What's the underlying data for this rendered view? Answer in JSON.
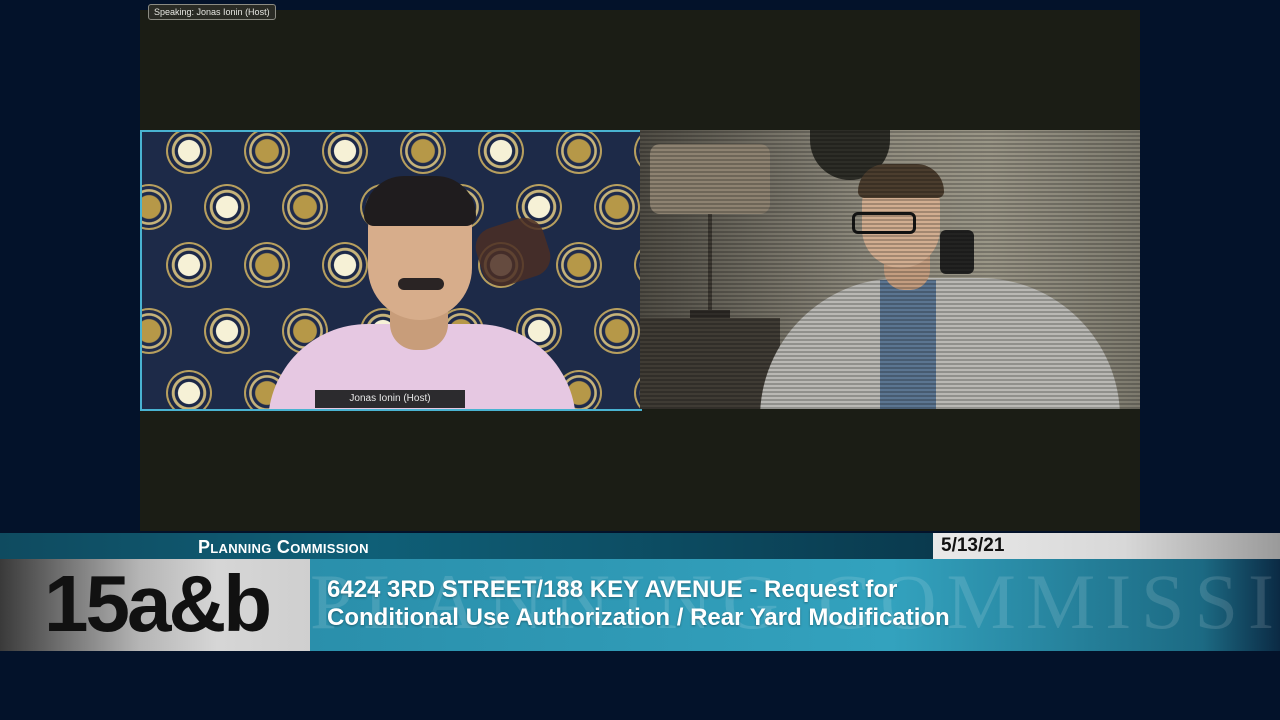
{
  "zoom": {
    "speaking_label": "Speaking: Jonas Ionin (Host)",
    "host_name_tag": "Jonas Ionin  (Host)"
  },
  "lower_third": {
    "program": "Planning Commission",
    "date": "5/13/21",
    "item_number": "15a&b",
    "item_line1": "6424 3RD STREET/188 KEY AVENUE - Request for",
    "item_line2": "Conditional Use Authorization / Rear Yard Modification",
    "watermark": "PLANNING COMMISSION"
  },
  "colors": {
    "active_speaker_border": "#49b3d1",
    "title_bar": "#0f5f77",
    "description_bar": "#33a2be"
  }
}
